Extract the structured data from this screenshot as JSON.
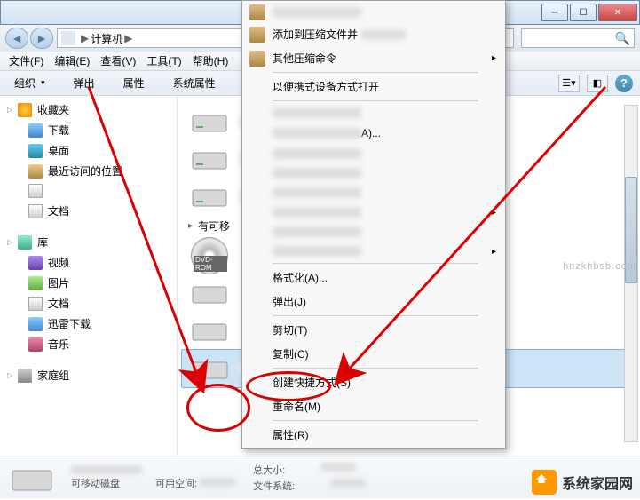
{
  "breadcrumb": {
    "computer": "计算机",
    "sep": "▶"
  },
  "menus": {
    "file": "文件(F)",
    "edit": "编辑(E)",
    "view": "查看(V)",
    "tools": "工具(T)",
    "help": "帮助(H)"
  },
  "toolbar": {
    "organize": "组织",
    "eject": "弹出",
    "properties": "属性",
    "sysproperties": "系统属性"
  },
  "sidebar": {
    "fav": {
      "title": "收藏夹",
      "items": [
        "下载",
        "桌面",
        "最近访问的位置",
        "",
        "文档"
      ]
    },
    "lib": {
      "title": "库",
      "items": [
        "视频",
        "图片",
        "文档",
        "迅雷下载",
        "音乐"
      ]
    },
    "home": {
      "title": "家庭组"
    }
  },
  "main": {
    "removable_header": "有可移",
    "dvd": "DVD-ROM"
  },
  "context": {
    "add_compress": "添加到压缩文件并",
    "other_compress": "其他压缩命令",
    "portable": "以便携式设备方式打开",
    "blur_a": "A)...",
    "format": "格式化(A)...",
    "eject": "弹出(J)",
    "cut": "剪切(T)",
    "copy": "复制(C)",
    "shortcut": "创建快捷方式(S)",
    "rename": "重命名(M)",
    "properties": "属性(R)"
  },
  "status": {
    "type": "可移动磁盘",
    "freespace_label": "可用空间:",
    "totalsize_label": "总大小:",
    "filesystem_label": "文件系统:"
  },
  "brand": "系统家园网",
  "watermark": "hnzkhbsb.com"
}
